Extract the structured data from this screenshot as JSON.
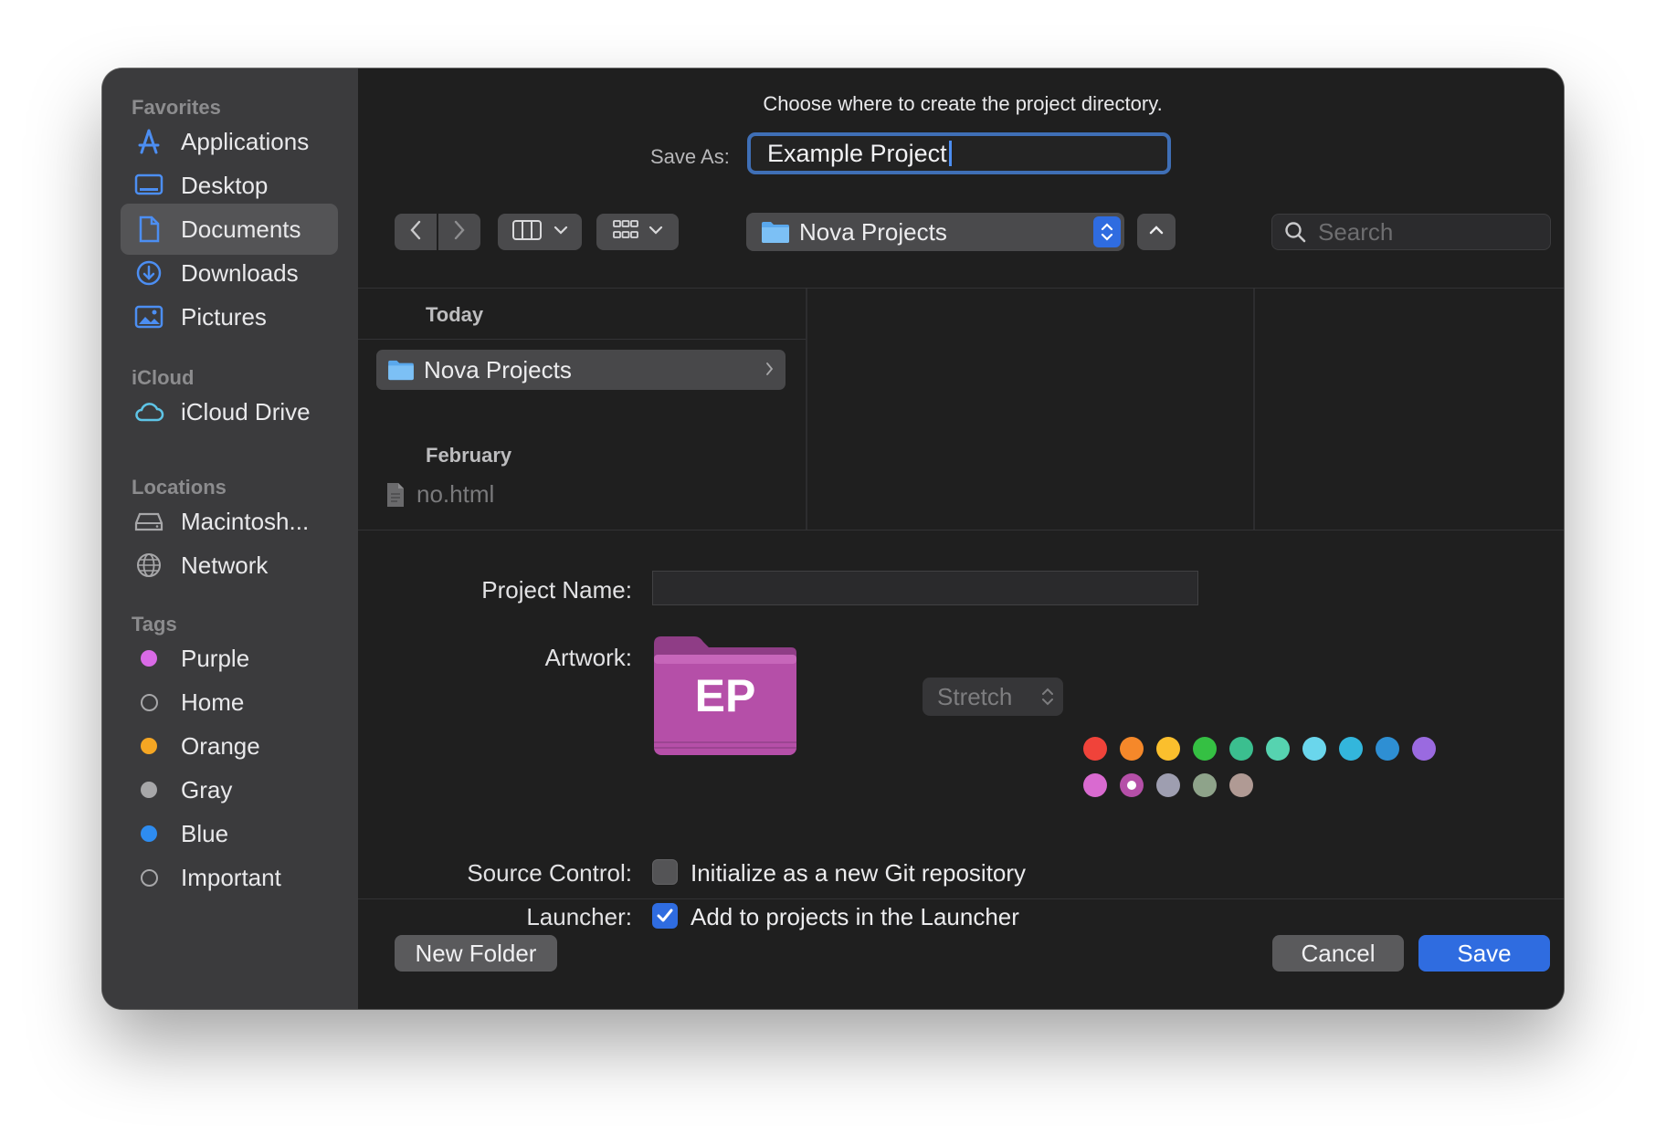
{
  "sidebar": {
    "sections": {
      "favorites": "Favorites",
      "icloud": "iCloud",
      "locations": "Locations",
      "tags": "Tags"
    },
    "favorites": [
      {
        "label": "Applications",
        "icon": "applications-icon"
      },
      {
        "label": "Desktop",
        "icon": "desktop-icon"
      },
      {
        "label": "Documents",
        "icon": "document-icon",
        "selected": true
      },
      {
        "label": "Downloads",
        "icon": "download-icon"
      },
      {
        "label": "Pictures",
        "icon": "pictures-icon"
      }
    ],
    "icloud": [
      {
        "label": "iCloud Drive",
        "icon": "cloud-icon"
      }
    ],
    "locations": [
      {
        "label": "Macintosh...",
        "icon": "drive-icon"
      },
      {
        "label": "Network",
        "icon": "globe-icon"
      }
    ],
    "tags": [
      {
        "label": "Purple",
        "color": "#d96ae6"
      },
      {
        "label": "Home",
        "color": "none"
      },
      {
        "label": "Orange",
        "color": "#f5a623"
      },
      {
        "label": "Gray",
        "color": "#a7a7a9"
      },
      {
        "label": "Blue",
        "color": "#2e8cf0"
      },
      {
        "label": "Important",
        "color": "none"
      }
    ]
  },
  "header": {
    "prompt": "Choose where to create the project directory.",
    "save_as_label": "Save As:",
    "save_as_value": "Example Project"
  },
  "toolbar": {
    "location": "Nova Projects",
    "search_placeholder": "Search"
  },
  "browser": {
    "groups": [
      {
        "label": "Today",
        "items": [
          {
            "name": "Nova Projects",
            "type": "folder",
            "selected": true
          }
        ]
      },
      {
        "label": "February",
        "items": [
          {
            "name": "no.html",
            "type": "file",
            "dimmed": true
          }
        ]
      }
    ]
  },
  "form": {
    "project_name_label": "Project Name:",
    "project_name_value": "",
    "artwork_label": "Artwork:",
    "artwork_initials": "EP",
    "artwork_color": "#b54fa8",
    "stretch_value": "Stretch",
    "swatches_row1": [
      "#f0433a",
      "#f5882a",
      "#fbbf2d",
      "#35c043",
      "#3bbf8f",
      "#56d3b0",
      "#6ad6ec",
      "#33b6dc",
      "#2e8fd3",
      "#9a6ae0"
    ],
    "swatches_row2": [
      "#d96ad0",
      "#b54fa8",
      "#9e9eb0",
      "#8ea38a",
      "#b09a94"
    ],
    "selected_swatch_row2_index": 1,
    "source_control_label": "Source Control:",
    "source_control_option": "Initialize as a new Git repository",
    "source_control_checked": false,
    "launcher_label": "Launcher:",
    "launcher_option": "Add to projects in the Launcher",
    "launcher_checked": true
  },
  "footer": {
    "new_folder": "New Folder",
    "cancel": "Cancel",
    "save": "Save"
  }
}
